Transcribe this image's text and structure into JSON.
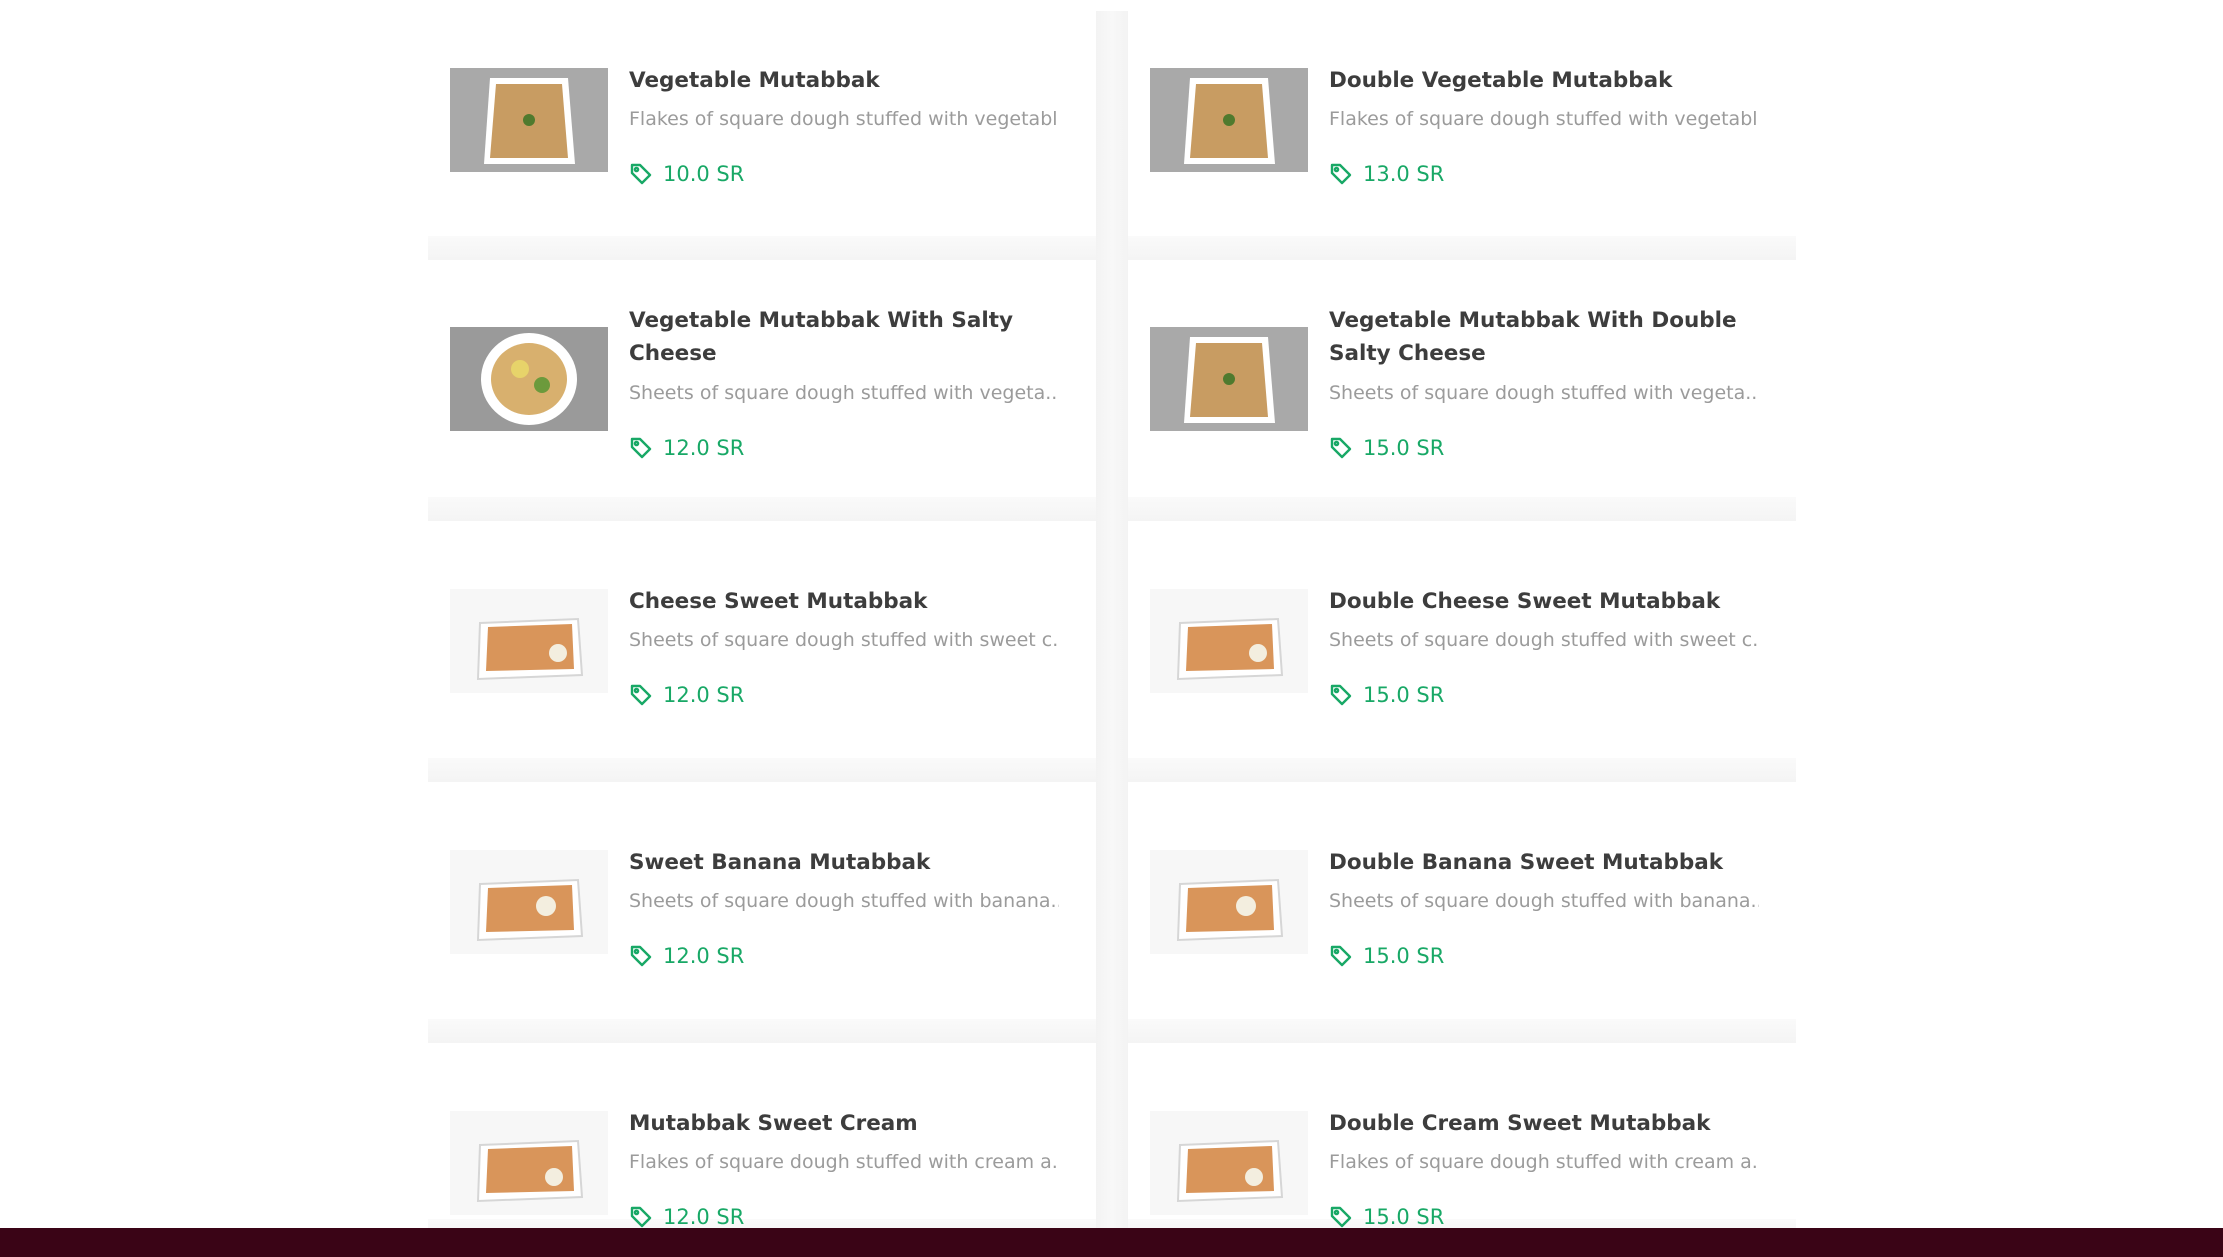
{
  "menu": {
    "items": [
      {
        "title": "Vegetable Mutabbak",
        "desc": "Flakes of square dough stuffed with vegetabl...",
        "price": "10.0 SR",
        "photo": "gray-square-dough"
      },
      {
        "title": "Double Vegetable Mutabbak",
        "desc": "Flakes of square dough stuffed with vegetabl...",
        "price": "13.0 SR",
        "photo": "gray-square-dough"
      },
      {
        "title": "Vegetable Mutabbak With Salty Cheese",
        "desc": "Sheets of square dough stuffed with vegeta...",
        "price": "12.0 SR",
        "photo": "round-plate-cheese"
      },
      {
        "title": "Vegetable Mutabbak With Double Salty Cheese",
        "desc": "Sheets of square dough stuffed with vegeta...",
        "price": "15.0 SR",
        "photo": "gray-square-dough"
      },
      {
        "title": "Cheese Sweet Mutabbak",
        "desc": "Sheets of square dough stuffed with sweet c...",
        "price": "12.0 SR",
        "photo": "white-plate-sweet"
      },
      {
        "title": "Double Cheese Sweet Mutabbak",
        "desc": "Sheets of square dough stuffed with sweet c...",
        "price": "15.0 SR",
        "photo": "white-plate-sweet"
      },
      {
        "title": "Sweet Banana Mutabbak",
        "desc": "Sheets of square dough stuffed with banana...",
        "price": "12.0 SR",
        "photo": "white-plate-sweet"
      },
      {
        "title": "Double Banana Sweet Mutabbak",
        "desc": "Sheets of square dough stuffed with banana...",
        "price": "15.0 SR",
        "photo": "white-plate-sweet"
      },
      {
        "title": "Mutabbak Sweet Cream",
        "desc": "Flakes of square dough stuffed with cream a...",
        "price": "12.0 SR",
        "photo": "white-plate-sweet"
      },
      {
        "title": "Double Cream Sweet Mutabbak",
        "desc": "Flakes of square dough stuffed with cream a...",
        "price": "15.0 SR",
        "photo": "white-plate-sweet"
      }
    ]
  },
  "icons": {
    "price": "tag-icon"
  },
  "colors": {
    "price": "#18a866",
    "title": "#3d3d3d",
    "desc": "#9b9b9b",
    "footer": "#3a0416"
  }
}
